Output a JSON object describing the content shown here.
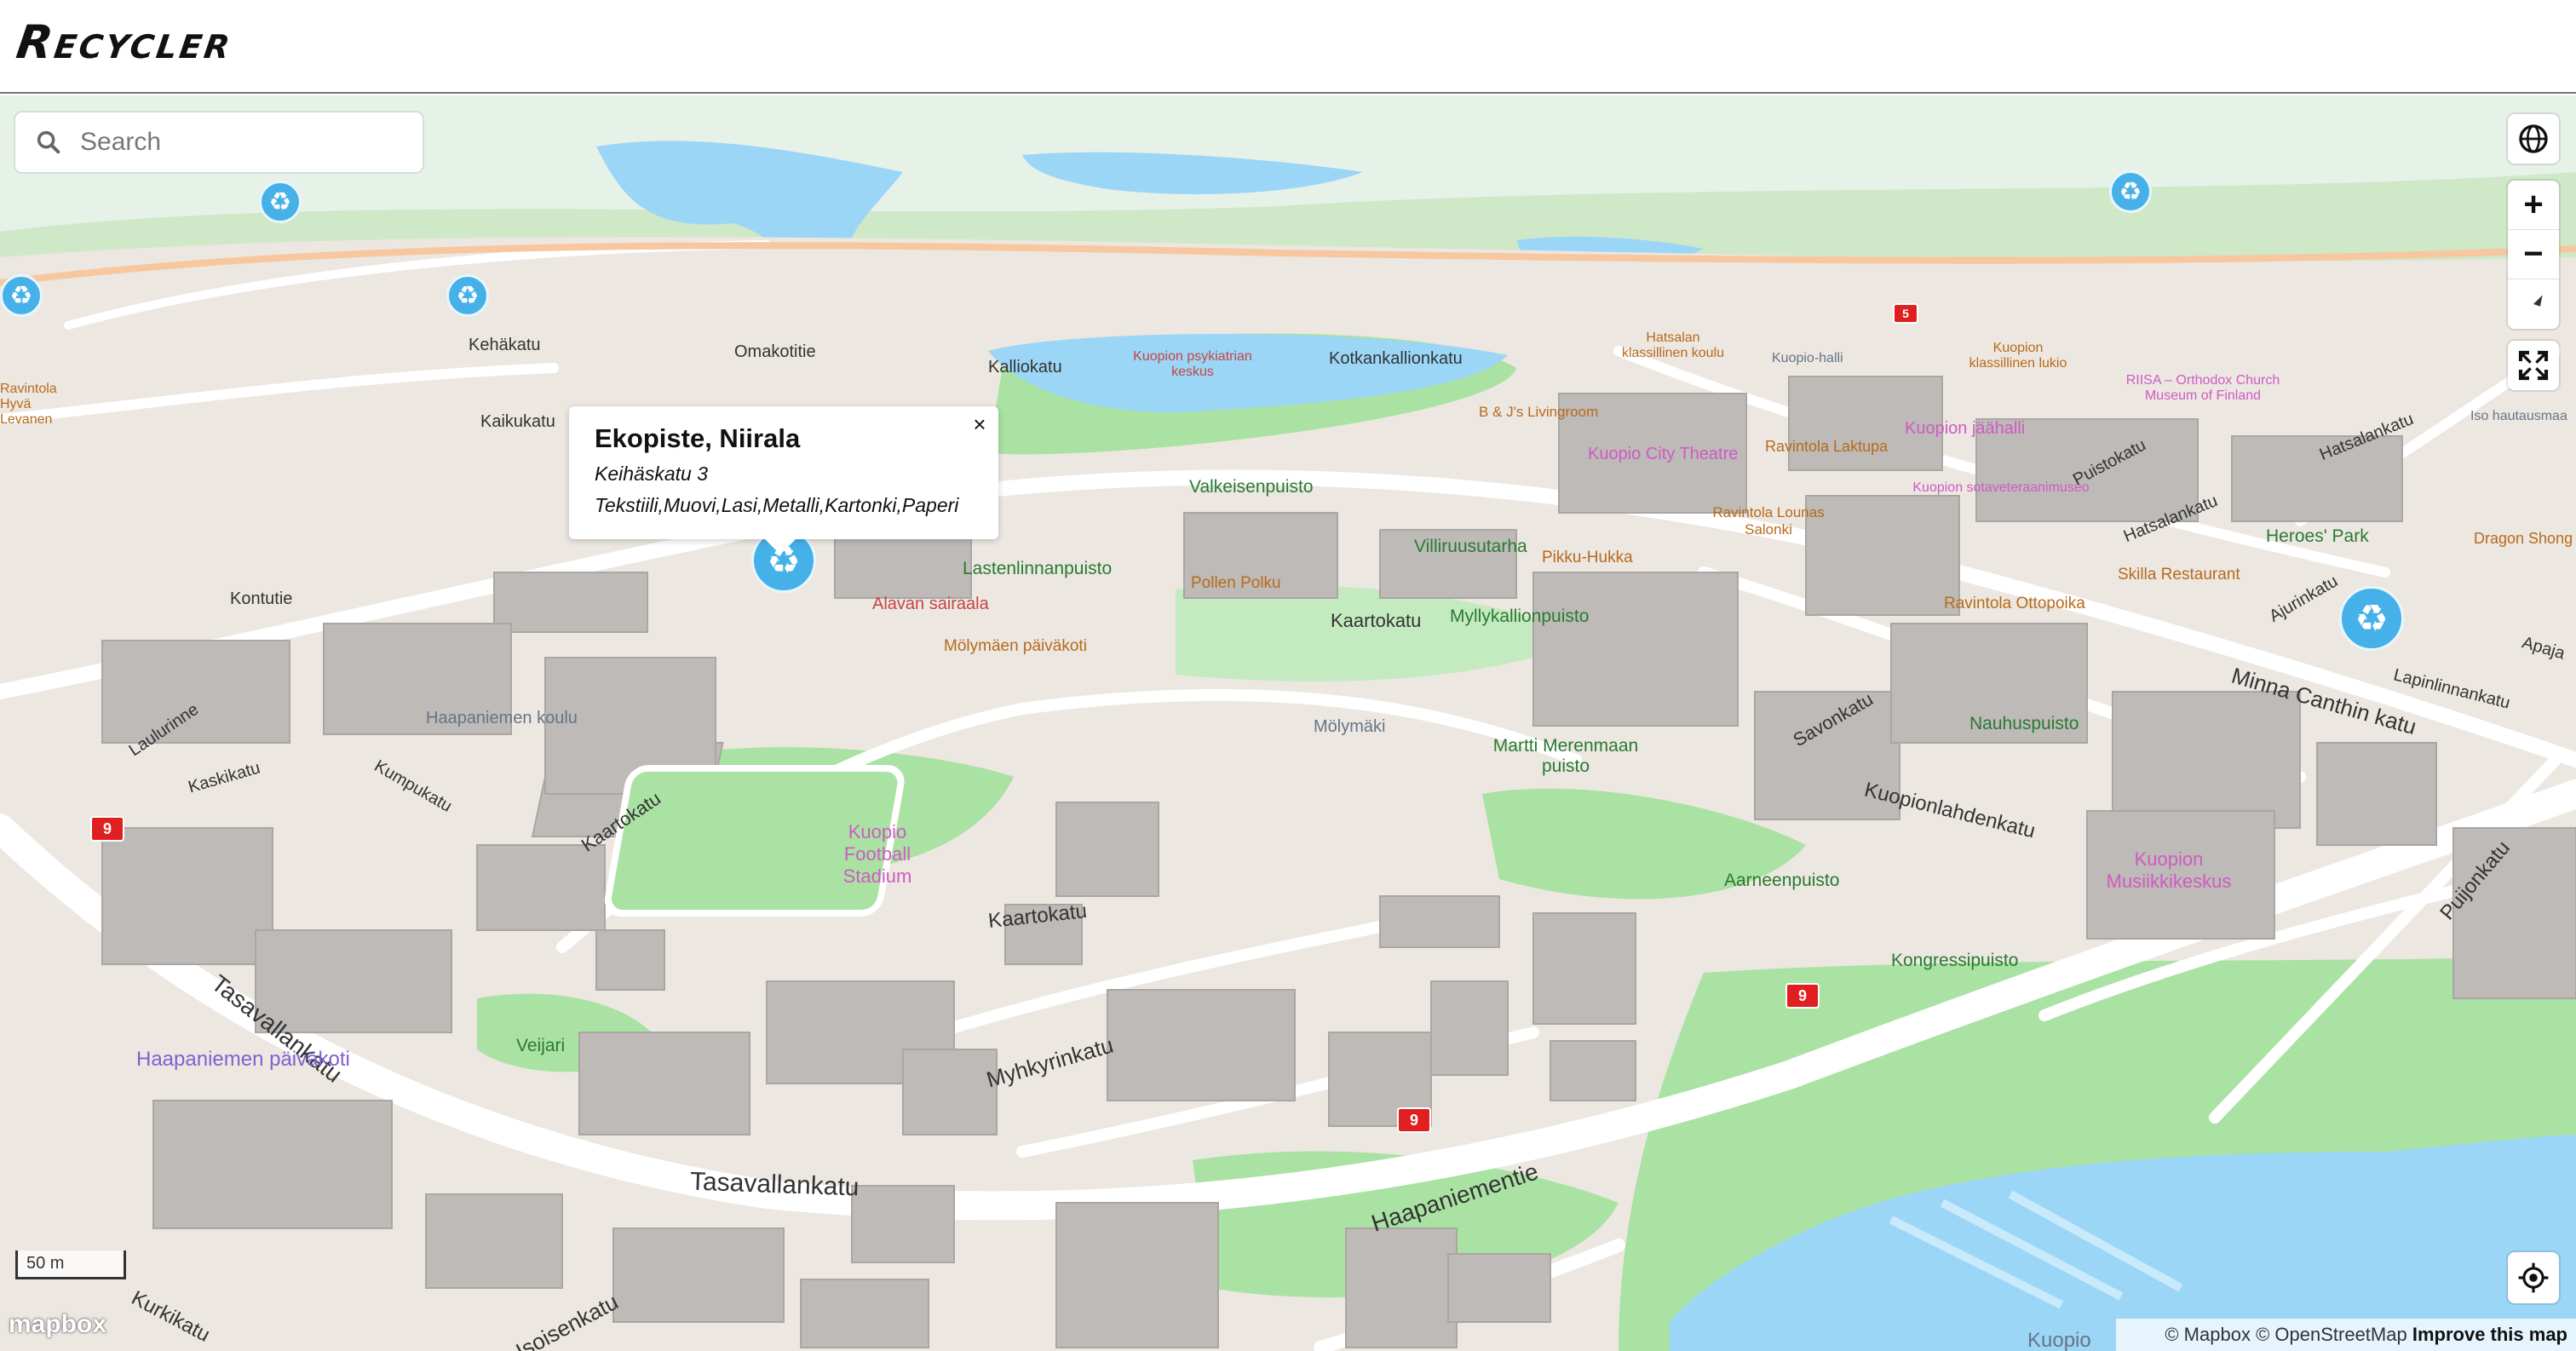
{
  "app": {
    "title": "Recycler"
  },
  "search": {
    "placeholder": "Search",
    "value": ""
  },
  "controls": {
    "globe": "globe-icon",
    "zoom_in": "+",
    "zoom_out": "−",
    "compass": "compass-icon",
    "fullscreen": "fullscreen-icon",
    "geolocate": "geolocate-icon"
  },
  "popup": {
    "title": "Ekopiste, Niirala",
    "address": "Keihäskatu 3",
    "materials": "Tekstiili,Muovi,Lasi,Metalli,Kartonki,Paperi",
    "close": "×"
  },
  "map_labels": {
    "roads": [
      "Kehäkatu",
      "Omakotitie",
      "Kalliokatu",
      "Kotkankallionkatu",
      "Kaikukatu",
      "Kontutie",
      "Laulurinne",
      "Kaskikatu",
      "Kumpukatu",
      "Kaartokatu",
      "Kaartokatu",
      "Kaartokatu",
      "Tasavallankatu",
      "Myhkyrinkatu",
      "Tasavallankatu",
      "Haapaniementie",
      "Puistokatu",
      "Hatsalankatu",
      "Hatsalankatu",
      "Savonkatu",
      "Kuopionlahdenkatu",
      "Minna Canthin katu",
      "Ajurinkatu",
      "Lapinlinnankatu",
      "Puijonkatu",
      "Apaja",
      "Kurkikatu",
      "Isoisenkatu"
    ],
    "parks": [
      "Valkeisenpuisto",
      "Lastenlinnanpuisto",
      "Villiruusutarha",
      "Myllykallionpuisto",
      "Martti Merenmaan puisto",
      "Nauhuspuisto",
      "Aarneenpuisto",
      "Kongressipuisto",
      "Veijari",
      "Heroes' Park"
    ],
    "pois_pink": [
      "Kuopio Football Stadium",
      "Kuopio City Theatre",
      "Kuopion Musiikkikeskus",
      "Kuopion jäähalli",
      "RIISA – Orthodox Church Museum of Finland",
      "Kuopion sotaveteraanimuseo"
    ],
    "pois_orange": [
      "B & J's Livingroom",
      "Ravintola Laktupa",
      "Ravintola Lounas Salonki",
      "Pikku-Hukka",
      "Pollen Polku",
      "Skilla Restaurant",
      "Ravintola Ottopoika",
      "Dragon Shong",
      "Mölymäen päiväkoti",
      "Hatsalan klassillinen koulu",
      "Kuopion klassillinen lukio",
      "Ravintola Hyvä Levanen"
    ],
    "pois_red": [
      "Kuopion psykiatrian keskus",
      "Alavan sairaala"
    ],
    "pois_grey": [
      "Haapaniemen koulu",
      "Mölymäki",
      "Kuopio-halli",
      "Iso hautausmaa",
      "Kuopio"
    ],
    "pois_purple": [
      "Haapaniemen päiväkoti"
    ],
    "route_shields": [
      "9",
      "9",
      "9",
      "5"
    ]
  },
  "scale": {
    "label": "50 m"
  },
  "branding": {
    "logo": "mapbox"
  },
  "attribution": {
    "mapbox": "© Mapbox",
    "osm": "© OpenStreetMap",
    "improve": "Improve this map"
  },
  "colors": {
    "marker": "#45b1e8",
    "water": "#9bd6f7",
    "park": "#a9e2a2",
    "land": "#ece7e1",
    "building": "#bdbab7"
  }
}
